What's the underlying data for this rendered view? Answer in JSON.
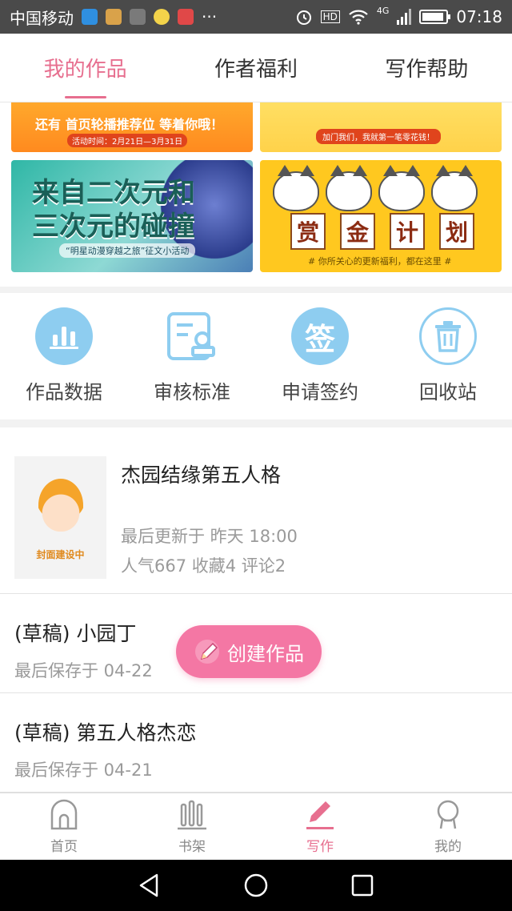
{
  "status_bar": {
    "carrier": "中国移动",
    "dots": "···",
    "hd": "HD",
    "net": "4G",
    "time": "07:18"
  },
  "tabs": [
    {
      "label": "我的作品",
      "active": true
    },
    {
      "label": "作者福利",
      "active": false
    },
    {
      "label": "写作帮助",
      "active": false
    }
  ],
  "banners": {
    "b1_text": "还有 首页轮播推荐位 等着你哦！",
    "b1_sub": "活动时间：2月21日—3月31日",
    "b2_sub": "加门我们，我就第一笔零花钱！",
    "b3_title": "来自二次元和三次元的碰撞",
    "b3_sub": "“明星动漫穿越之旅”征文小活动",
    "b4_chars": [
      "赏",
      "金",
      "计",
      "划"
    ],
    "b4_sub": "# 你所关心的更新福利，都在这里 #"
  },
  "actions": [
    {
      "label": "作品数据",
      "icon": "bar-chart-icon"
    },
    {
      "label": "审核标准",
      "icon": "document-stamp-icon"
    },
    {
      "label": "申请签约",
      "icon": "sign-icon"
    },
    {
      "label": "回收站",
      "icon": "trash-icon"
    }
  ],
  "works": {
    "main": {
      "title": "杰园结缘第五人格",
      "cover_label": "封面建设中",
      "updated": "最后更新于 昨天 18:00",
      "stats": "人气667 收藏4 评论2"
    },
    "drafts": [
      {
        "title": "(草稿) 小园丁",
        "saved": "最后保存于 04-22"
      },
      {
        "title": "(草稿) 第五人格杰恋",
        "saved": "最后保存于 04-21"
      }
    ]
  },
  "fab": {
    "label": "创建作品",
    "icon": "pencil-icon"
  },
  "bottom_nav": [
    {
      "label": "首页",
      "icon": "home-icon",
      "active": false
    },
    {
      "label": "书架",
      "icon": "bookshelf-icon",
      "active": false
    },
    {
      "label": "写作",
      "icon": "pencil-icon",
      "active": true
    },
    {
      "label": "我的",
      "icon": "profile-icon",
      "active": false
    }
  ],
  "colors": {
    "accent": "#e76f8f",
    "fab": "#f477a4",
    "icon_blue": "#8ecdf0"
  }
}
